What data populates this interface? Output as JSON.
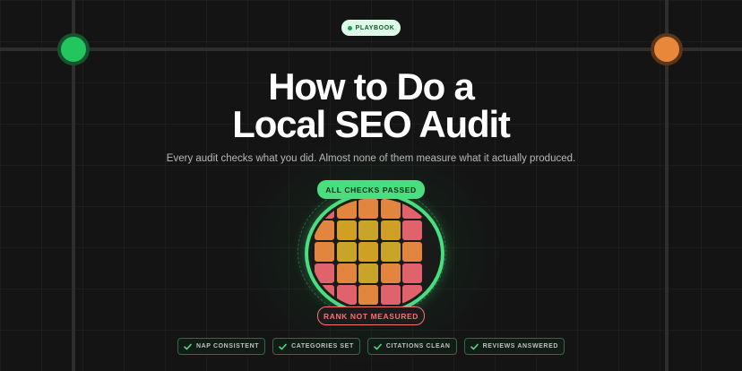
{
  "header": {
    "badge_label": "PLAYBOOK",
    "title_line1": "How to Do a",
    "title_line2": "Local SEO Audit",
    "subtitle": "Every audit checks what you did. Almost none of them measure what it actually produced."
  },
  "graphic": {
    "top_badge": "ALL CHECKS PASSED",
    "bottom_badge": "RANK NOT MEASURED",
    "cell_colors": [
      [
        "#e0636b",
        "#e2853f",
        "#e2853f",
        "#e2853f",
        "#e0636b"
      ],
      [
        "#e2853f",
        "#d0a024",
        "#c8a528",
        "#d0a024",
        "#e0636b"
      ],
      [
        "#e2853f",
        "#c8a528",
        "#d0a024",
        "#c8a528",
        "#e2853f"
      ],
      [
        "#e0636b",
        "#e2853f",
        "#c8a528",
        "#e2853f",
        "#e0636b"
      ],
      [
        "#e0636b",
        "#e0636b",
        "#e2853f",
        "#e0636b",
        "#e0636b"
      ]
    ]
  },
  "checks": [
    {
      "label": "NAP CONSISTENT"
    },
    {
      "label": "CATEGORIES SET"
    },
    {
      "label": "CITATIONS CLEAN"
    },
    {
      "label": "REVIEWS ANSWERED"
    }
  ],
  "colors": {
    "accent_green": "#4ade80",
    "accent_orange": "#e8873a",
    "alert_red": "#f87171",
    "background": "#141414"
  }
}
